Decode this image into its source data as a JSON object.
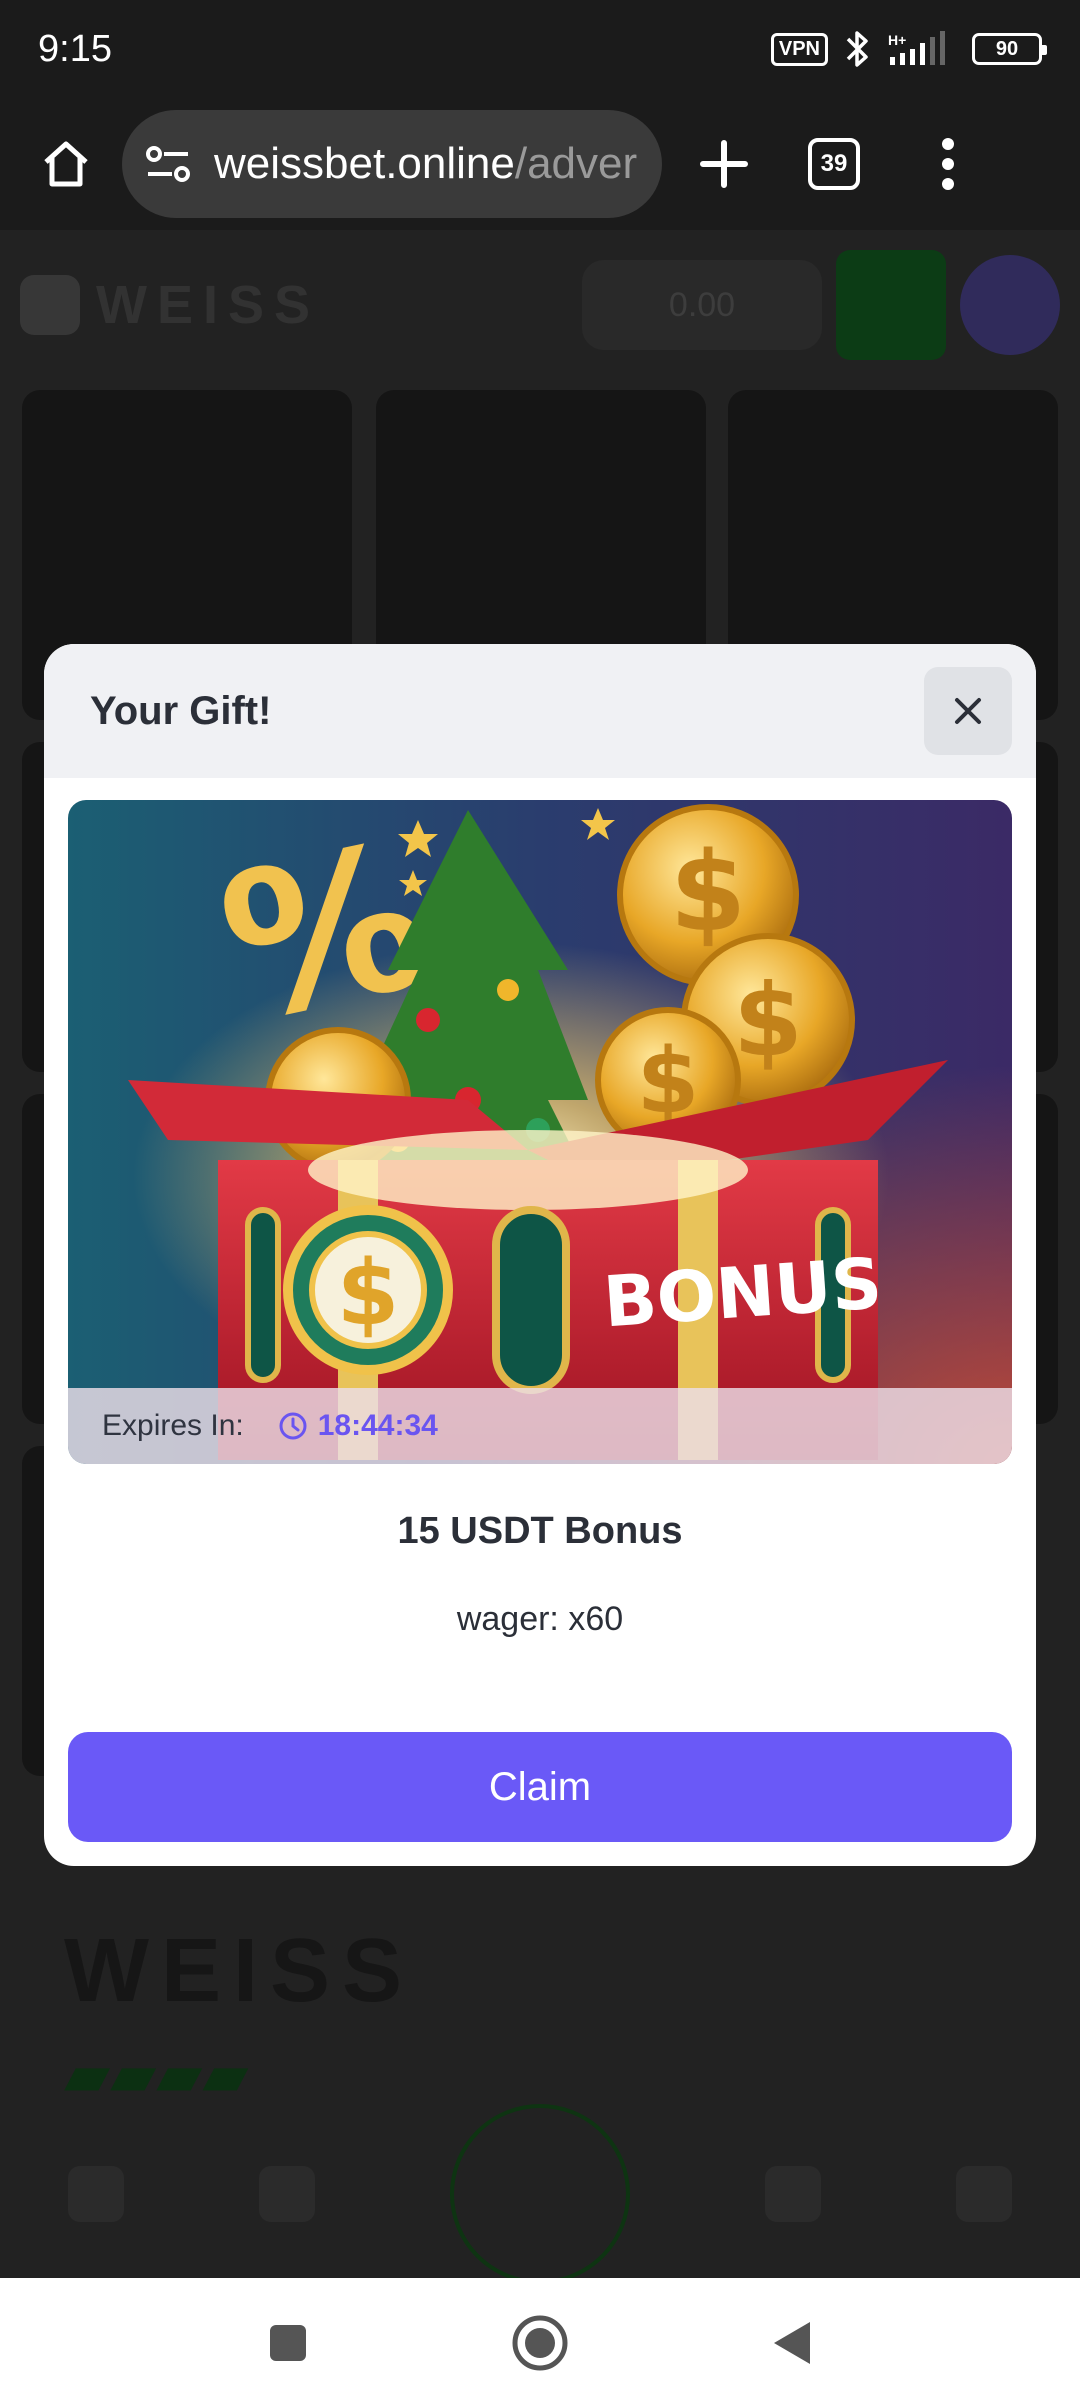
{
  "status_bar": {
    "time": "9:15",
    "vpn": "VPN",
    "network": "H+",
    "battery": "90",
    "icons": [
      "vpn-icon",
      "bluetooth-icon",
      "signal-icon",
      "battery-icon"
    ]
  },
  "browser": {
    "url_domain": "weissbet.online",
    "url_path": "/adver",
    "tabs_count": "39",
    "icons": [
      "home-icon",
      "site-settings-icon",
      "new-tab-icon",
      "tabs-icon",
      "more-icon"
    ]
  },
  "background_page": {
    "logo": "WEISS",
    "balance": "0.00",
    "footer_logo": "WEISS"
  },
  "modal": {
    "title": "Your Gift!",
    "expires_label": "Expires In:",
    "timer": "18:44:34",
    "banner_text": "BONUS",
    "offer_title": "15 USDT Bonus",
    "wager": "wager: x60",
    "claim_label": "Claim"
  },
  "colors": {
    "accent": "#6a59f7",
    "timer": "#6a55f0",
    "text": "#2b2f38",
    "banner_red": "#d4293a"
  }
}
